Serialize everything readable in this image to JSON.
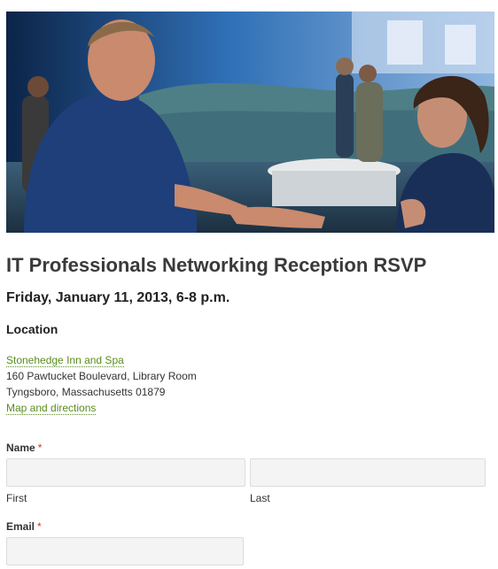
{
  "event": {
    "title": "IT Professionals Networking Reception RSVP",
    "date": "Friday, January 11, 2013, 6-8 p.m."
  },
  "location": {
    "heading": "Location",
    "venue": "Stonehedge Inn and Spa",
    "street": "160 Pawtucket Boulevard, Library Room",
    "city": "Tyngsboro, Massachusetts 01879",
    "map_link": "Map and directions"
  },
  "form": {
    "name_label": "Name",
    "required_mark": "*",
    "first_value": "",
    "last_value": "",
    "first_sublabel": "First",
    "last_sublabel": "Last",
    "email_label": "Email",
    "email_value": ""
  },
  "colors": {
    "link": "#5a8c1e",
    "required": "#c0392b",
    "input_bg": "#f4f4f4"
  }
}
